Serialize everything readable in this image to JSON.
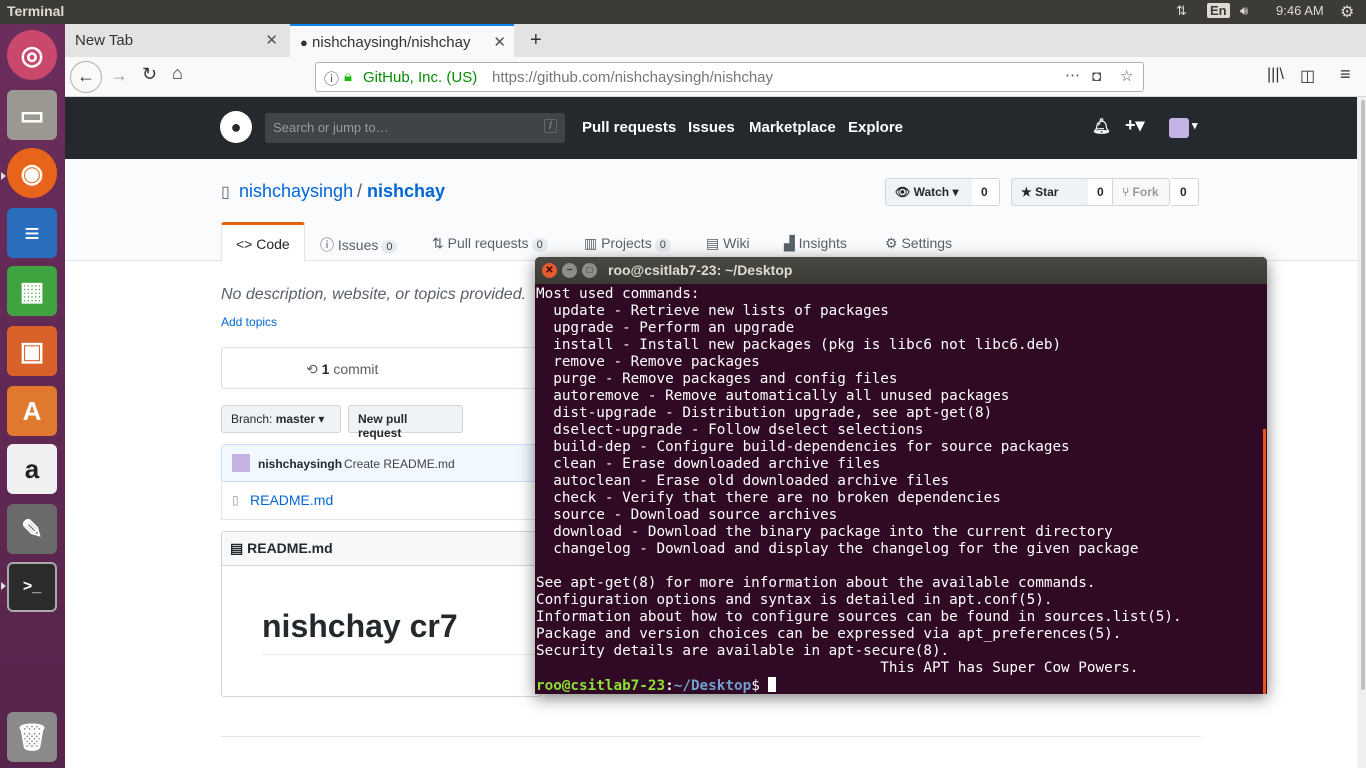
{
  "system": {
    "app_name": "Terminal",
    "keyboard_layout": "En",
    "clock": "9:46 AM"
  },
  "browser": {
    "tabs": [
      {
        "label": "New Tab"
      },
      {
        "label": "nishchaysingh/nishchay"
      }
    ],
    "url_identity": "GitHub, Inc. (US)",
    "url_prefix": "https://github.com/",
    "url_path": "nishchaysingh/nishchay"
  },
  "github": {
    "search_placeholder": "Search or jump to…",
    "search_key": "/",
    "nav": [
      "Pull requests",
      "Issues",
      "Marketplace",
      "Explore"
    ],
    "owner": "nishchaysingh",
    "separator": "/",
    "repo": "nishchay",
    "watch_label": "Watch",
    "watch_count": "0",
    "star_label": "Star",
    "star_count": "0",
    "fork_label": "Fork",
    "fork_count": "0",
    "tabs": {
      "code": "Code",
      "issues": "Issues",
      "issues_count": "0",
      "pulls": "Pull requests",
      "pulls_count": "0",
      "projects": "Projects",
      "projects_count": "0",
      "wiki": "Wiki",
      "insights": "Insights",
      "settings": "Settings"
    },
    "description": "No description, website, or topics provided.",
    "add_topics": "Add topics",
    "commit_count": "1",
    "commit_label": "commit",
    "branch_prefix": "Branch:",
    "branch_name": "master",
    "new_pr": "New pull request",
    "last_commit_author": "nishchaysingh",
    "last_commit_msg": "Create README.md",
    "file_name": "README.md",
    "readme_header": "README.md",
    "readme_heading": "nishchay cr7"
  },
  "terminal": {
    "title": "roo@csitlab7-23: ~/Desktop",
    "lines": [
      "Most used commands:",
      "  update - Retrieve new lists of packages",
      "  upgrade - Perform an upgrade",
      "  install - Install new packages (pkg is libc6 not libc6.deb)",
      "  remove - Remove packages",
      "  purge - Remove packages and config files",
      "  autoremove - Remove automatically all unused packages",
      "  dist-upgrade - Distribution upgrade, see apt-get(8)",
      "  dselect-upgrade - Follow dselect selections",
      "  build-dep - Configure build-dependencies for source packages",
      "  clean - Erase downloaded archive files",
      "  autoclean - Erase old downloaded archive files",
      "  check - Verify that there are no broken dependencies",
      "  source - Download source archives",
      "  download - Download the binary package into the current directory",
      "  changelog - Download and display the changelog for the given package",
      "",
      "See apt-get(8) for more information about the available commands.",
      "Configuration options and syntax is detailed in apt.conf(5).",
      "Information about how to configure sources can be found in sources.list(5).",
      "Package and version choices can be expressed via apt_preferences(5).",
      "Security details are available in apt-secure(8).",
      "                                        This APT has Super Cow Powers."
    ],
    "prompt_user": "roo@csitlab7-23",
    "prompt_sep": ":",
    "prompt_path": "~/Desktop",
    "prompt_end": "$ "
  }
}
